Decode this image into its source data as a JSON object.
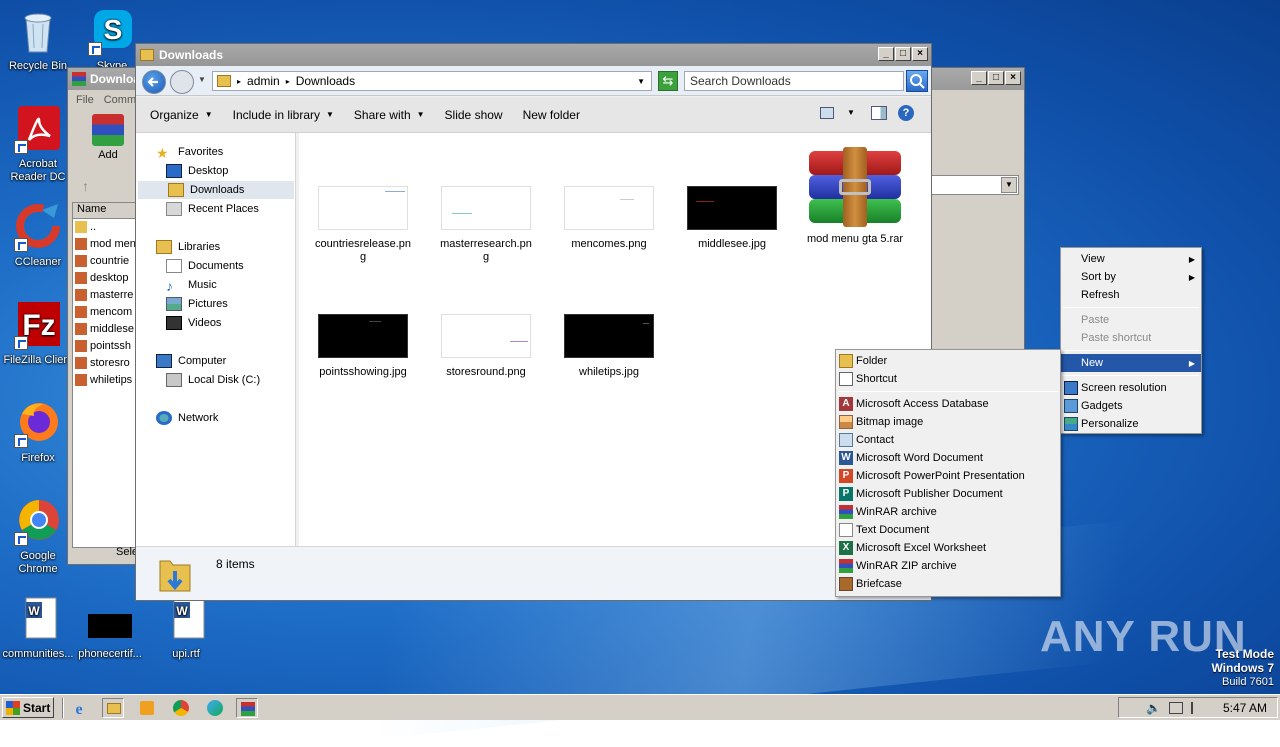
{
  "desktop": {
    "icons": [
      {
        "label": "Recycle Bin"
      },
      {
        "label": "Skype"
      },
      {
        "label": "Acrobat Reader DC"
      },
      {
        "label": "CCleaner"
      },
      {
        "label": "FileZilla Client"
      },
      {
        "label": "Firefox"
      },
      {
        "label": "Google Chrome"
      },
      {
        "label": "communities..."
      },
      {
        "label": "phonecertif..."
      },
      {
        "label": "upi.rtf"
      }
    ]
  },
  "rar_window": {
    "title": "Downloa",
    "menu": [
      "File",
      "Comm"
    ],
    "add_label": "Add",
    "column_name": "Name",
    "files": [
      "..",
      "mod men",
      "countrie",
      "desktop",
      "masterre",
      "mencom",
      "middlese",
      "pointssh",
      "storesro",
      "whiletips"
    ],
    "status": "Sele"
  },
  "explorer": {
    "title": "Downloads",
    "breadcrumb": [
      "admin",
      "Downloads"
    ],
    "search_placeholder": "Search Downloads",
    "toolbar": {
      "organize": "Organize",
      "include_in_library": "Include in library",
      "share_with": "Share with",
      "slide_show": "Slide show",
      "new_folder": "New folder"
    },
    "nav": {
      "favorites": "Favorites",
      "desktop": "Desktop",
      "downloads": "Downloads",
      "recent_places": "Recent Places",
      "libraries": "Libraries",
      "documents": "Documents",
      "music": "Music",
      "pictures": "Pictures",
      "videos": "Videos",
      "computer": "Computer",
      "local_disk": "Local Disk (C:)",
      "network": "Network"
    },
    "files": [
      {
        "name_line1": "countriesrelease.pn",
        "name_line2": "g"
      },
      {
        "name_line1": "masterresearch.pn",
        "name_line2": "g"
      },
      {
        "name_line1": "mencomes.png",
        "name_line2": ""
      },
      {
        "name_line1": "middlesee.jpg",
        "name_line2": ""
      },
      {
        "name_line1": "mod menu gta 5.rar",
        "name_line2": ""
      },
      {
        "name_line1": "pointsshowing.jpg",
        "name_line2": ""
      },
      {
        "name_line1": "storesround.png",
        "name_line2": ""
      },
      {
        "name_line1": "whiletips.jpg",
        "name_line2": ""
      }
    ],
    "status_count": "8 items"
  },
  "context_menu": {
    "view": "View",
    "sort_by": "Sort by",
    "refresh": "Refresh",
    "paste": "Paste",
    "paste_shortcut": "Paste shortcut",
    "new": "New",
    "screen_resolution": "Screen resolution",
    "gadgets": "Gadgets",
    "personalize": "Personalize"
  },
  "new_submenu": {
    "folder": "Folder",
    "shortcut": "Shortcut",
    "access_db": "Microsoft Access Database",
    "bitmap": "Bitmap image",
    "contact": "Contact",
    "word_doc": "Microsoft Word Document",
    "ppt": "Microsoft PowerPoint Presentation",
    "publisher": "Microsoft Publisher Document",
    "winrar": "WinRAR archive",
    "text_doc": "Text Document",
    "excel": "Microsoft Excel Worksheet",
    "winrar_zip": "WinRAR ZIP archive",
    "briefcase": "Briefcase"
  },
  "taskbar": {
    "start": "Start",
    "clock": "5:47 AM"
  },
  "watermark": "ANY RUN",
  "test_mode": {
    "line1": "Test Mode",
    "line2": "Windows 7",
    "line3": "Build 7601"
  }
}
